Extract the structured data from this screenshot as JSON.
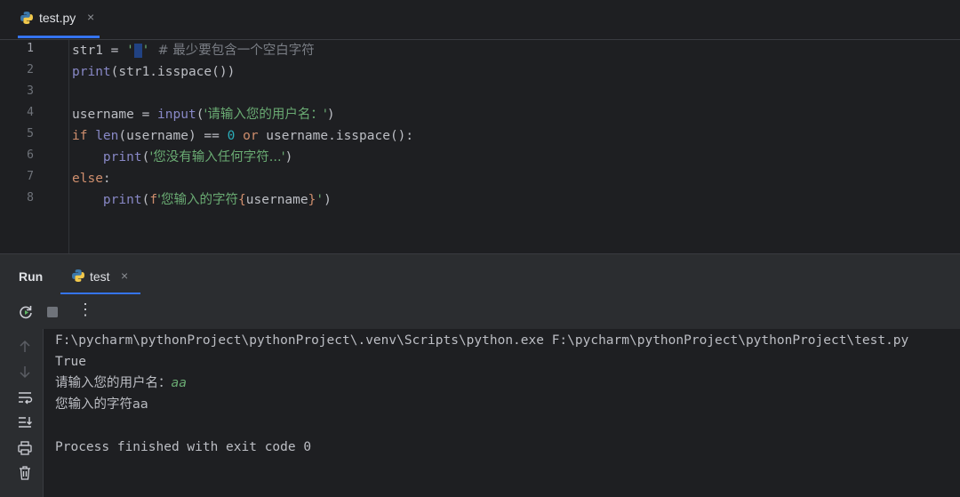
{
  "editor_tab": {
    "label": "test.py",
    "close": "×"
  },
  "editor": {
    "line_numbers": [
      "1",
      "2",
      "3",
      "4",
      "5",
      "6",
      "7",
      "8"
    ],
    "lines": {
      "l1_var": "str1 = ",
      "l1_str_open": "'",
      "l1_str_space": " ",
      "l1_str_close": "'",
      "l1_comment": "  # 最少要包含一个空白字符",
      "l2_fn": "print",
      "l2_rest": "(str1.isspace())",
      "l4_var": "username = ",
      "l4_fn": "input",
      "l4_open": "(",
      "l4_str": "'请输入您的用户名：'",
      "l4_close": ")",
      "l5_if": "if ",
      "l5_len": "len",
      "l5_mid": "(username) == ",
      "l5_num": "0",
      "l5_or": " or ",
      "l5_rest": "username.isspace():",
      "l6_indent": "    ",
      "l6_fn": "print",
      "l6_open": "(",
      "l6_str": "'您没有输入任何字符...'",
      "l6_close": ")",
      "l7_else": "else",
      "l7_colon": ":",
      "l8_indent": "    ",
      "l8_fn": "print",
      "l8_open": "(",
      "l8_f": "f",
      "l8_str": "'您输入的字符",
      "l8_brace_open": "{",
      "l8_var": "username",
      "l8_brace_close": "}",
      "l8_str_end": "'",
      "l8_close": ")"
    }
  },
  "run_panel": {
    "title": "Run",
    "tab_label": "test",
    "tab_close": "×",
    "menu": "⋮"
  },
  "console": {
    "cmd": "F:\\pycharm\\pythonProject\\pythonProject\\.venv\\Scripts\\python.exe F:\\pycharm\\pythonProject\\pythonProject\\test.py",
    "out1": "True",
    "prompt": "请输入您的用户名：",
    "input": "aa",
    "out2": "您输入的字符aa",
    "finish": "Process finished with exit code 0"
  },
  "colors": {
    "accent": "#3574f0",
    "keyword": "#cf8e6d",
    "function": "#56a8f5",
    "string": "#6aab73",
    "number": "#2aacb8",
    "comment": "#7a7e85"
  }
}
